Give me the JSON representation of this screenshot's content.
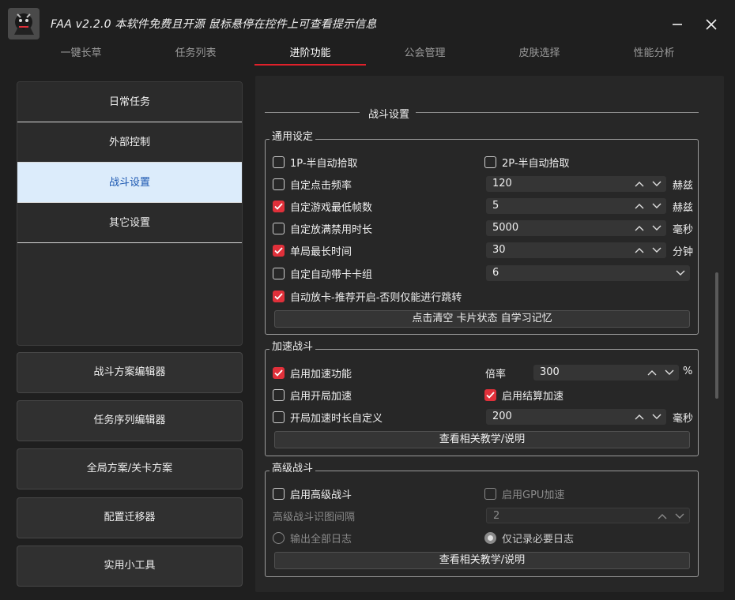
{
  "app": {
    "title": "FAA v2.2.0 本软件免费且开源 鼠标悬停在控件上可查看提示信息",
    "logo": "faa-logo"
  },
  "tabs": [
    {
      "label": "一键长草"
    },
    {
      "label": "任务列表"
    },
    {
      "label": "进阶功能"
    },
    {
      "label": "公会管理"
    },
    {
      "label": "皮肤选择"
    },
    {
      "label": "性能分析"
    }
  ],
  "nav": {
    "items": [
      {
        "label": "日常任务"
      },
      {
        "label": "外部控制"
      },
      {
        "label": "战斗设置"
      },
      {
        "label": "其它设置"
      }
    ]
  },
  "left_buttons": [
    {
      "label": "战斗方案编辑器"
    },
    {
      "label": "任务序列编辑器"
    },
    {
      "label": "全局方案/关卡方案"
    },
    {
      "label": "配置迁移器"
    },
    {
      "label": "实用小工具"
    }
  ],
  "section_title": "战斗设置",
  "general": {
    "title": "通用设定",
    "p1_pickup": {
      "label": "1P-半自动拾取",
      "checked": false
    },
    "p2_pickup": {
      "label": "2P-半自动拾取",
      "checked": false
    },
    "click_freq": {
      "label": "自定点击频率",
      "checked": false,
      "value": "120",
      "unit": "赫兹"
    },
    "min_fps": {
      "label": "自定游戏最低帧数",
      "checked": true,
      "value": "5",
      "unit": "赫兹"
    },
    "disable_time": {
      "label": "自定放满禁用时长",
      "checked": false,
      "value": "5000",
      "unit": "毫秒"
    },
    "max_time": {
      "label": "单局最长时间",
      "checked": true,
      "value": "30",
      "unit": "分钟"
    },
    "card_group": {
      "label": "自定自动带卡卡组",
      "checked": false,
      "value": "6"
    },
    "auto_place": {
      "label": "自动放卡-推荐开启-否则仅能进行跳转",
      "checked": true
    },
    "clear_button": "点击清空 卡片状态 自学习记忆"
  },
  "accel": {
    "title": "加速战斗",
    "enable": {
      "label": "启用加速功能",
      "checked": true
    },
    "rate": {
      "label": "倍率",
      "value": "300",
      "unit": "%"
    },
    "start_accel": {
      "label": "启用开局加速",
      "checked": false
    },
    "end_accel": {
      "label": "启用结算加速",
      "checked": true
    },
    "custom_duration": {
      "label": "开局加速时长自定义",
      "checked": false,
      "value": "200",
      "unit": "毫秒"
    },
    "tutorial_button": "查看相关教学/说明"
  },
  "advanced": {
    "title": "高级战斗",
    "enable": {
      "label": "启用高级战斗",
      "checked": false
    },
    "gpu": {
      "label": "启用GPU加速",
      "checked": false
    },
    "interval": {
      "label": "高级战斗识图间隔",
      "value": "2"
    },
    "log_all": {
      "label": "输出全部日志",
      "selected": false
    },
    "log_necessary": {
      "label": "仅记录必要日志",
      "selected": true
    },
    "tutorial_button": "查看相关教学/说明"
  },
  "colors": {
    "accent": "#e0303a",
    "active_nav_bg": "#dcecfb",
    "active_nav_text": "#1a56b0"
  }
}
